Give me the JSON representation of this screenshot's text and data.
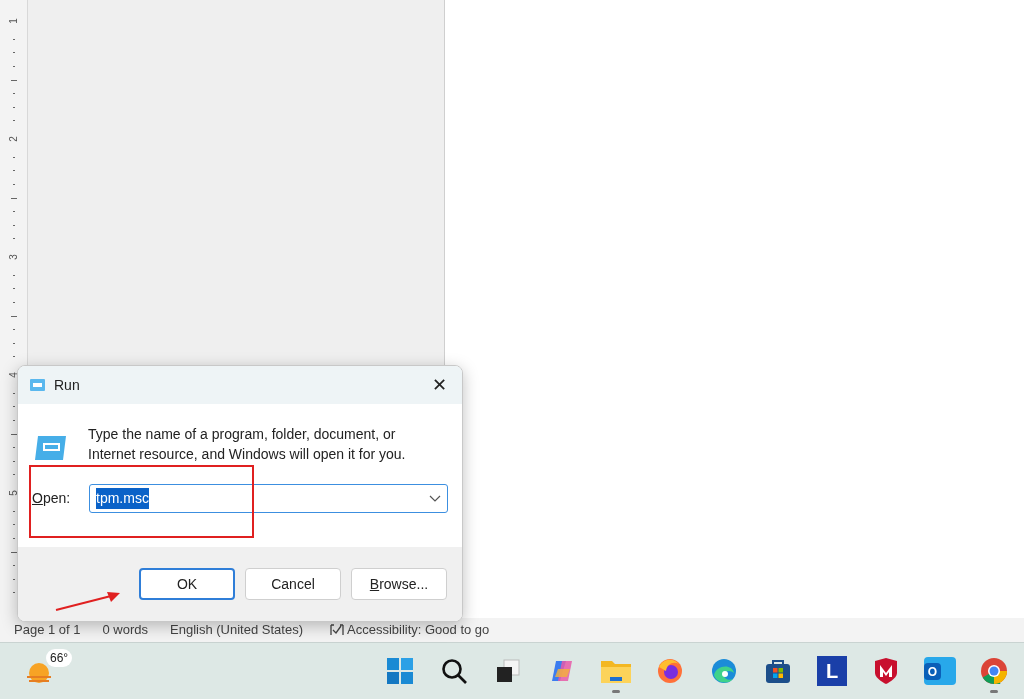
{
  "ruler": {
    "labels": [
      "1",
      "2",
      "3",
      "4",
      "5"
    ]
  },
  "status_bar": {
    "items": [
      {
        "kind": "text",
        "text": "Page 1 of 1"
      },
      {
        "kind": "text",
        "text": "0 words"
      },
      {
        "kind": "text",
        "text": "English (United States)"
      },
      {
        "kind": "accessibility",
        "text": "Accessibility: Good to go"
      }
    ]
  },
  "dialog": {
    "title": "Run",
    "close": "✕",
    "message": "Type the name of a program, folder, document, or Internet resource, and Windows will open it for you.",
    "open_label": {
      "text": "Open:",
      "underline_first": true
    },
    "field": {
      "value": "tpm.msc",
      "text_selected": true
    },
    "buttons": [
      {
        "label": "OK",
        "default": true,
        "underline_first": false
      },
      {
        "label": "Cancel",
        "default": false,
        "underline_first": false
      },
      {
        "label": "Browse...",
        "default": false,
        "underline_first": true
      }
    ]
  },
  "taskbar": {
    "weather": {
      "temperature": "66°"
    },
    "apps": [
      {
        "kind": "start",
        "running": false
      },
      {
        "kind": "search",
        "running": false
      },
      {
        "kind": "taskview",
        "running": false
      },
      {
        "kind": "copilot",
        "running": false
      },
      {
        "kind": "folder",
        "running": true
      },
      {
        "kind": "firefox",
        "running": false
      },
      {
        "kind": "edge",
        "running": false
      },
      {
        "kind": "store",
        "running": false
      },
      {
        "kind": "letter",
        "letter": "L",
        "running": false
      },
      {
        "kind": "shield",
        "running": false
      },
      {
        "kind": "outlook",
        "letter": "O",
        "running": false
      },
      {
        "kind": "chrome",
        "running": true
      }
    ]
  }
}
